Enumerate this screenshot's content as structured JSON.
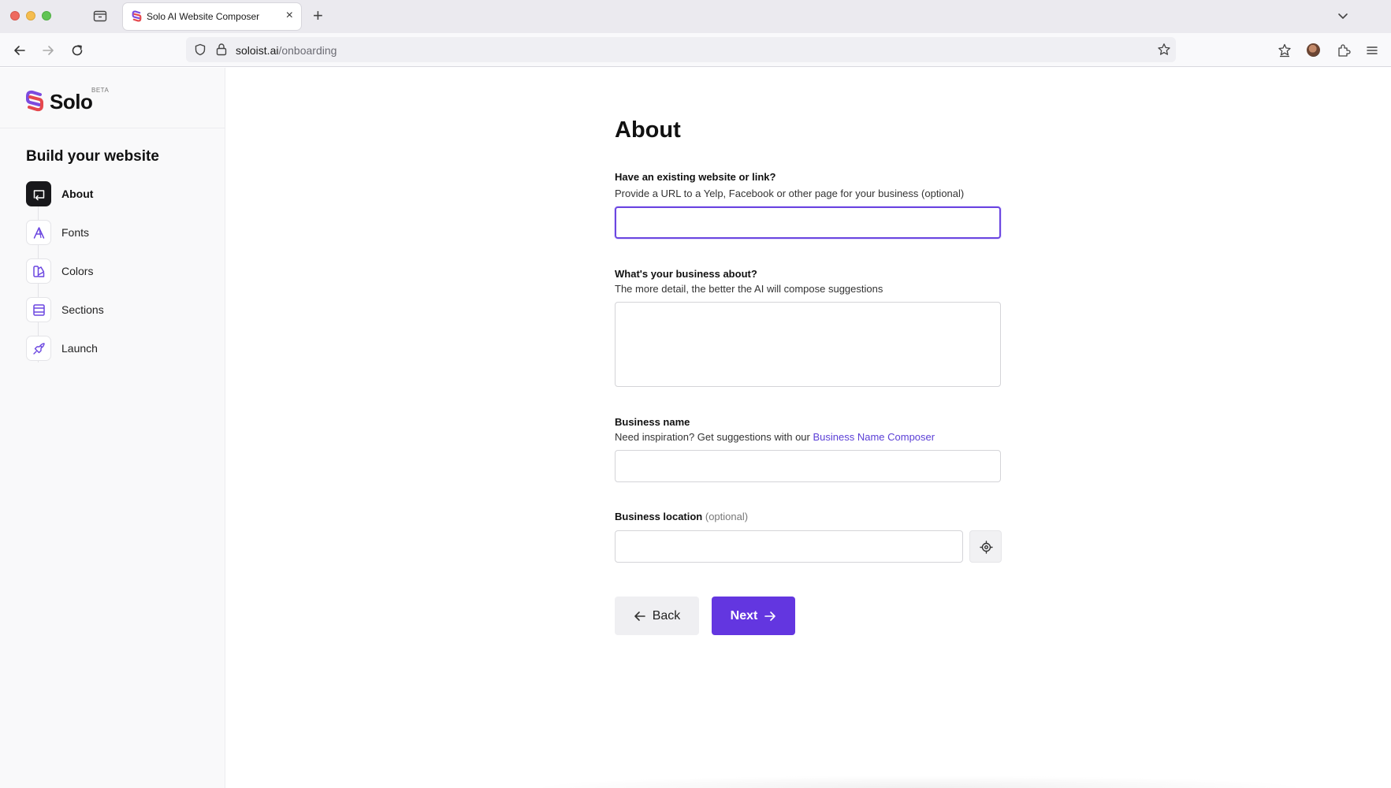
{
  "browser": {
    "tab_title": "Solo AI Website Composer",
    "tab_close": "×",
    "new_tab": "+",
    "url_host": "soloist.ai",
    "url_path": "/onboarding"
  },
  "brand": {
    "name": "Solo",
    "badge": "BETA"
  },
  "sidebar": {
    "heading": "Build your website",
    "steps": [
      {
        "label": "About",
        "icon": "about-icon",
        "active": true
      },
      {
        "label": "Fonts",
        "icon": "font-icon",
        "active": false
      },
      {
        "label": "Colors",
        "icon": "palette-icon",
        "active": false
      },
      {
        "label": "Sections",
        "icon": "layout-icon",
        "active": false
      },
      {
        "label": "Launch",
        "icon": "rocket-icon",
        "active": false
      }
    ]
  },
  "form": {
    "title": "About",
    "website": {
      "label": "Have an existing website or link?",
      "help": "Provide a URL to a Yelp, Facebook or other page for your business (optional)",
      "value": ""
    },
    "about": {
      "label": "What's your business about?",
      "help": "The more detail, the better the AI will compose suggestions",
      "value": ""
    },
    "name": {
      "label": "Business name",
      "help_prefix": "Need inspiration? Get suggestions with our ",
      "help_link": "Business Name Composer",
      "value": ""
    },
    "location": {
      "label": "Business location",
      "optional": "(optional)",
      "value": ""
    },
    "back_label": "Back",
    "next_label": "Next"
  },
  "colors": {
    "accent": "#6336e0",
    "link": "#5b3fd6",
    "active_step": "#18181b"
  }
}
